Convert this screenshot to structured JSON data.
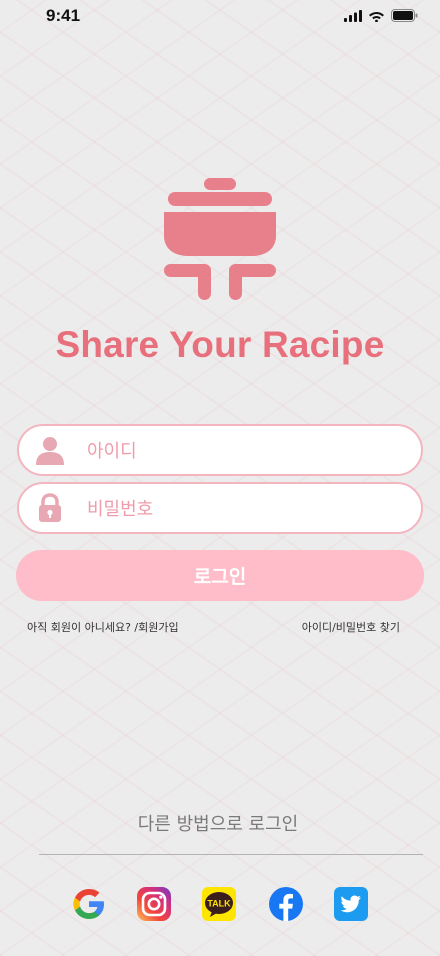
{
  "status_bar": {
    "time": "9:41",
    "icons": [
      "signal-icon",
      "wifi-icon",
      "battery-icon"
    ]
  },
  "app": {
    "title": "Share Your Racipe",
    "logo": "cooking-pot-icon",
    "brand_color": "#e8707c"
  },
  "login_form": {
    "id_placeholder": "아이디",
    "password_placeholder": "비밀번호",
    "login_label": "로그인"
  },
  "links": {
    "signup": "아직 회원이 아니세요? /회원가입",
    "find_account": "아이디/비밀번호 찾기"
  },
  "alt_login": {
    "label": "다른 방법으로 로그인",
    "providers": [
      "google-icon",
      "instagram-icon",
      "kakaotalk-icon",
      "facebook-icon",
      "twitter-icon"
    ],
    "kakao_text": "TALK"
  },
  "colors": {
    "field_border": "#f3b6c0",
    "button_bg": "#ffbcc9",
    "placeholder": "#ef9bab"
  }
}
